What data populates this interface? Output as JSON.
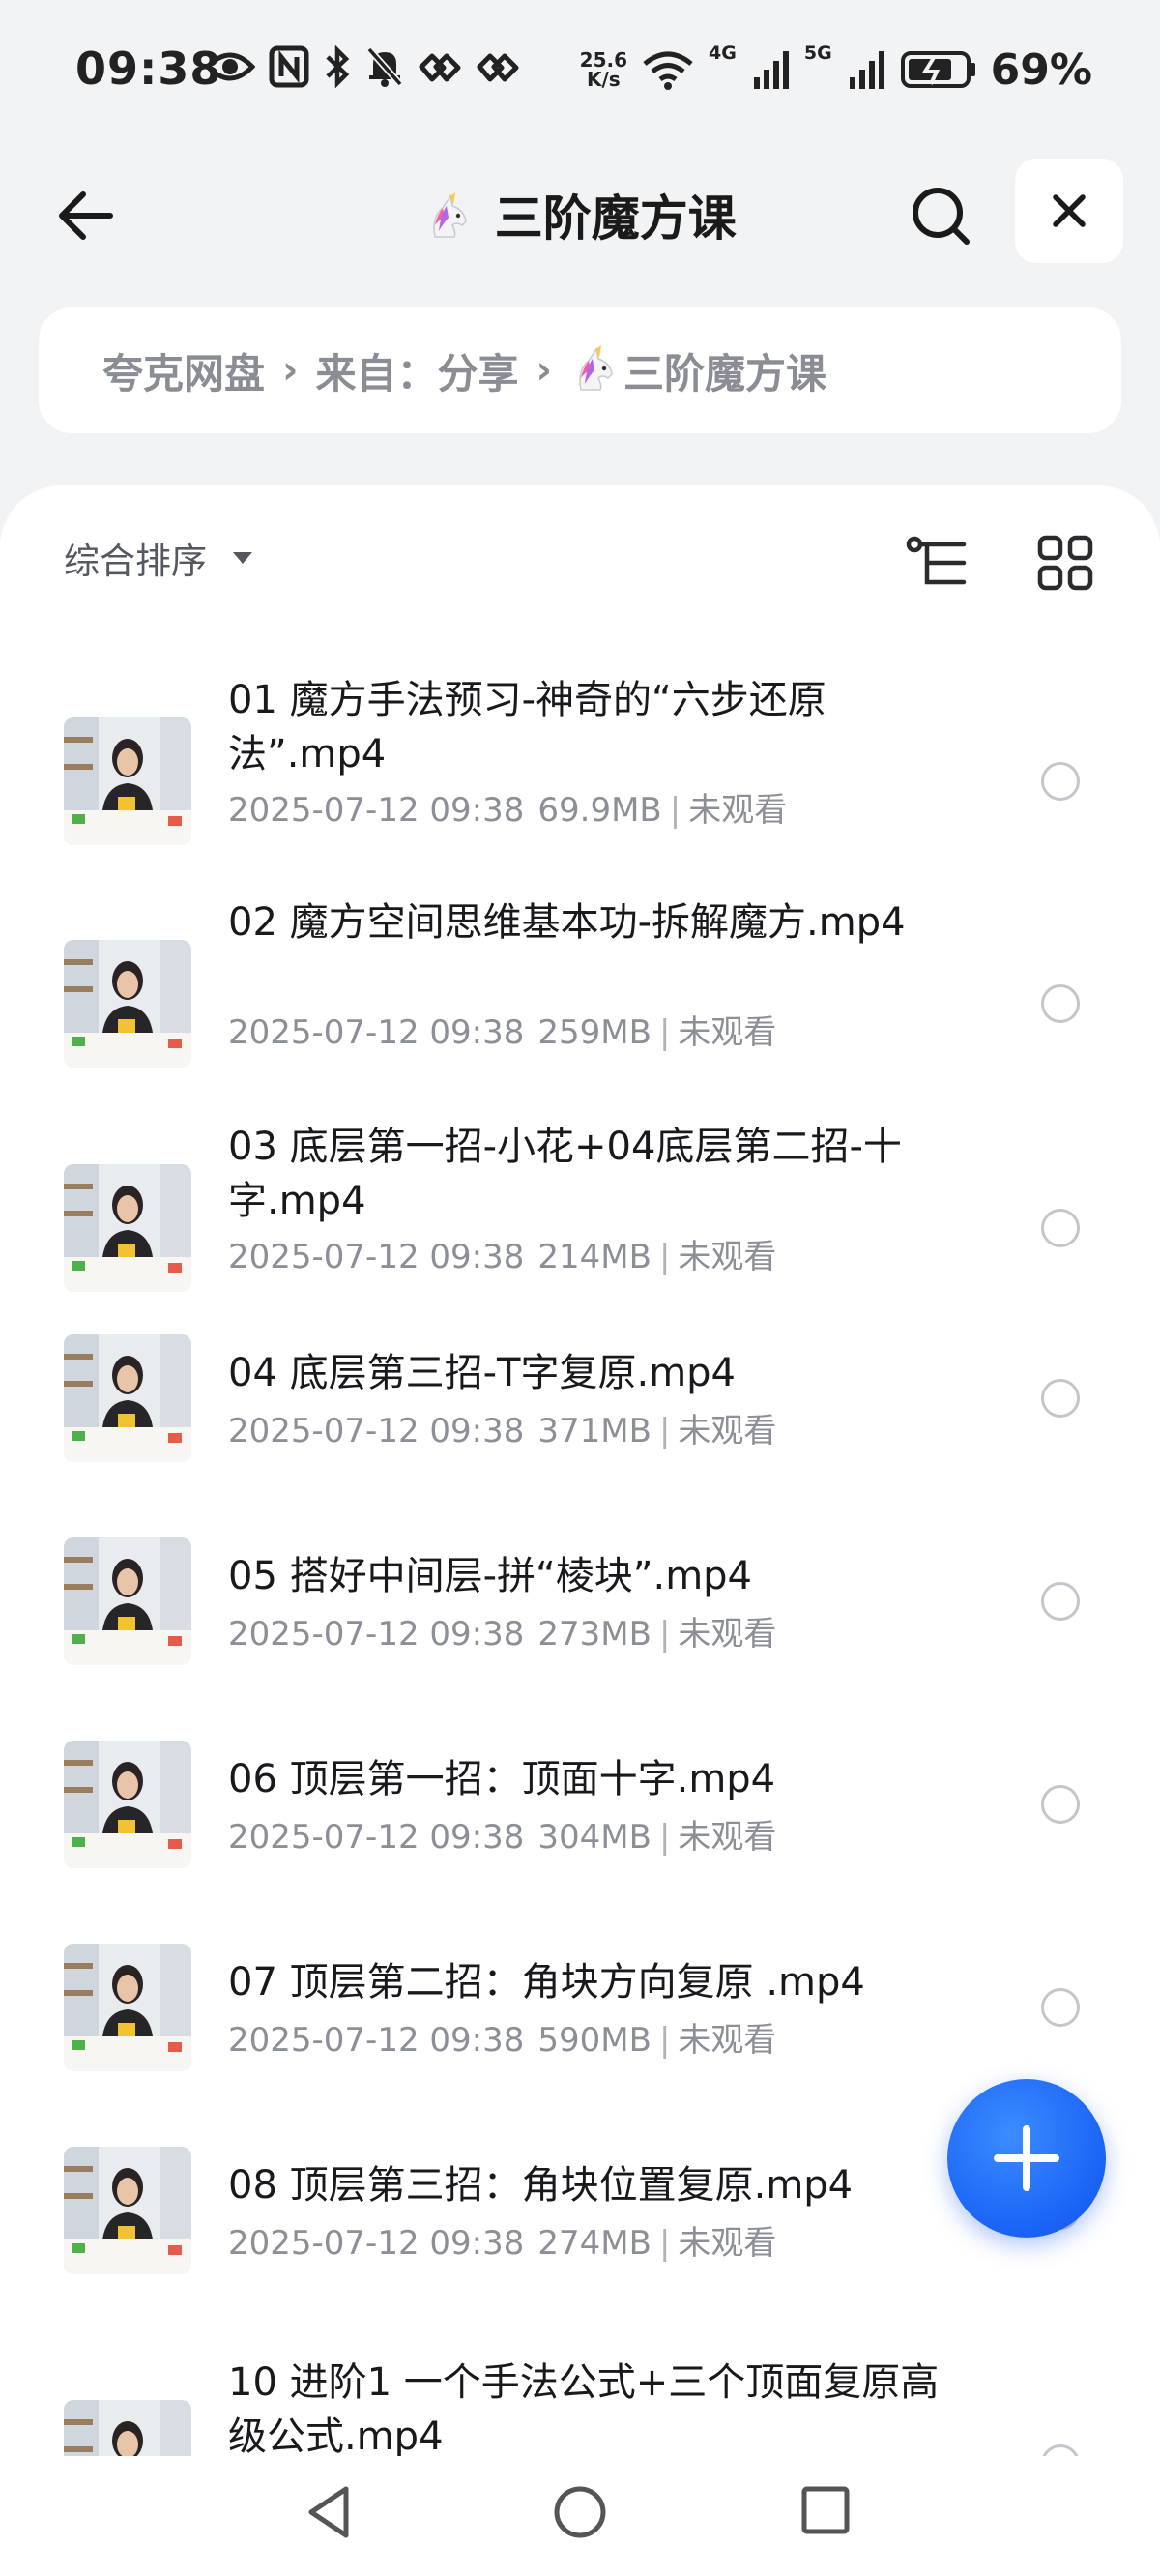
{
  "status_bar": {
    "time": "09:38",
    "net_speed_value": "25.6",
    "net_speed_unit": "K/s",
    "signal1_label": "4G",
    "signal2_label": "5G",
    "battery": "69%",
    "left_icons": [
      "eye-icon",
      "nfc-icon",
      "bluetooth-icon",
      "bell-off-icon",
      "app-icon",
      "app-icon"
    ]
  },
  "header": {
    "title": "三阶魔方课",
    "title_icon": "unicorn-icon"
  },
  "breadcrumb": {
    "items": [
      "夸克网盘",
      "来自：分享",
      "三阶魔方课"
    ]
  },
  "toolbar": {
    "sort_label": "综合排序"
  },
  "files": [
    {
      "name": "01  魔方手法预习-神奇的“六步还原法”.mp4",
      "date": "2025-07-12 09:38",
      "size": "69.9MB",
      "status": "未观看"
    },
    {
      "name": "02 魔方空间思维基本功-拆解魔方.mp4",
      "date": "2025-07-12 09:38",
      "size": "259MB",
      "status": "未观看"
    },
    {
      "name": "03 底层第一招-小花+04底层第二招-十字.mp4",
      "date": "2025-07-12 09:38",
      "size": "214MB",
      "status": "未观看"
    },
    {
      "name": "04 底层第三招-T字复原.mp4",
      "date": "2025-07-12 09:38",
      "size": "371MB",
      "status": "未观看"
    },
    {
      "name": "05 搭好中间层-拼“棱块”.mp4",
      "date": "2025-07-12 09:38",
      "size": "273MB",
      "status": "未观看"
    },
    {
      "name": "06 顶层第一招：顶面十字.mp4",
      "date": "2025-07-12 09:38",
      "size": "304MB",
      "status": "未观看"
    },
    {
      "name": "07 顶层第二招：角块方向复原 .mp4",
      "date": "2025-07-12 09:38",
      "size": "590MB",
      "status": "未观看"
    },
    {
      "name": "08 顶层第三招：角块位置复原.mp4",
      "date": "2025-07-12 09:38",
      "size": "274MB",
      "status": "未观看"
    },
    {
      "name": "10 进阶1 一个手法公式+三个顶面复原高级公式.mp4",
      "date": "",
      "size": "",
      "status": ""
    }
  ],
  "colors": {
    "accent": "#1a63f5",
    "background": "#f2f3f5",
    "meta_text": "#8c8f96"
  }
}
